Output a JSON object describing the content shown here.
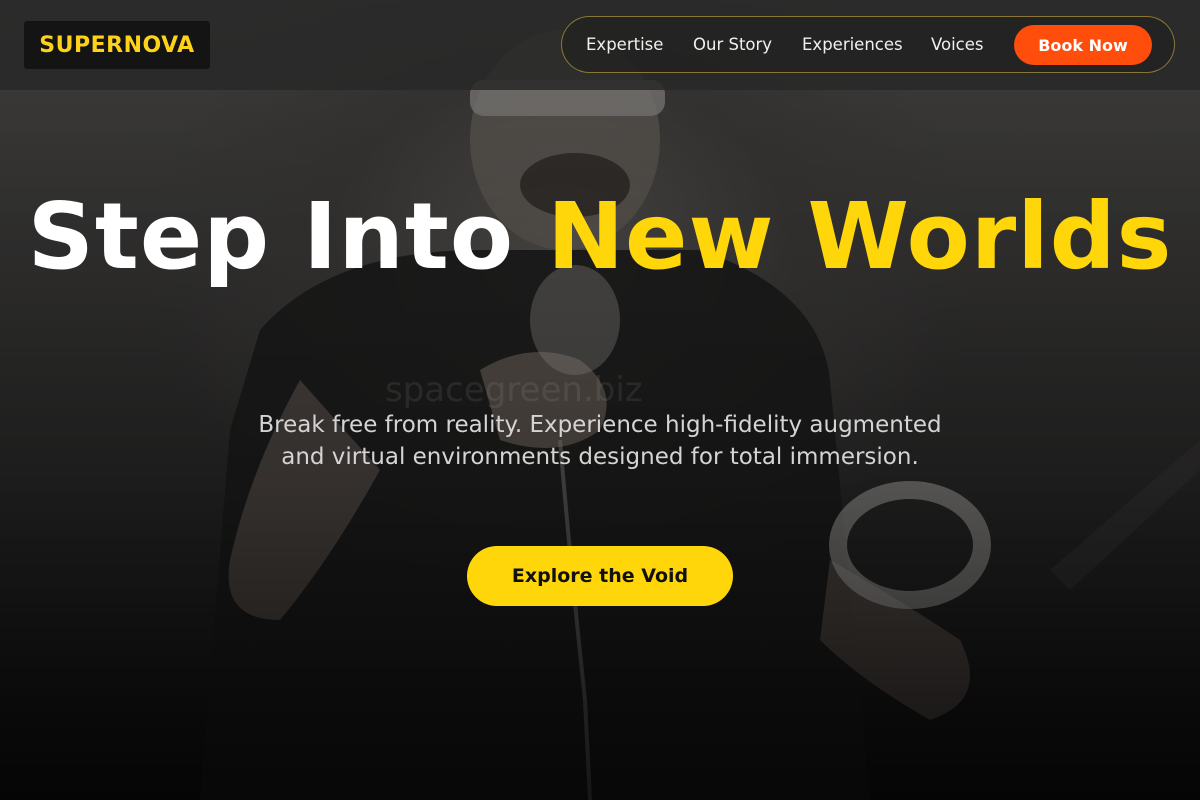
{
  "header": {
    "logo_text": "SUPERNOVA",
    "nav": [
      {
        "label": "Expertise"
      },
      {
        "label": "Our Story"
      },
      {
        "label": "Experiences"
      },
      {
        "label": "Voices"
      }
    ],
    "cta_label": "Book Now"
  },
  "hero": {
    "title_part1": "Step Into ",
    "title_accent": "New Worlds",
    "subtitle": "Break free from reality. Experience high-fidelity augmented and virtual environments designed for total immersion.",
    "cta_label": "Explore the Void",
    "watermark": "spacegreen.biz"
  },
  "colors": {
    "accent_yellow": "#ffd60a",
    "accent_orange": "#ff4d0c",
    "header_bg": "#282828"
  }
}
